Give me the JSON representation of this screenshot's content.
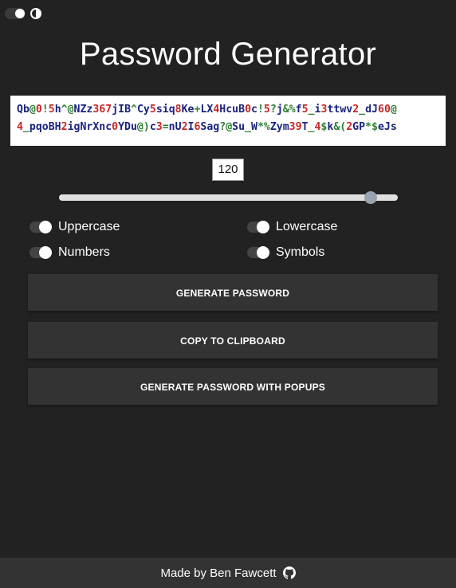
{
  "app": {
    "title": "Password Generator"
  },
  "theme_toggle": {
    "icon": "contrast-icon"
  },
  "password": {
    "segments": [
      [
        {
          "t": "Qb",
          "c": "upper"
        },
        {
          "t": "@",
          "c": "symbol"
        },
        {
          "t": "0",
          "c": "number"
        },
        {
          "t": "!",
          "c": "symbol"
        },
        {
          "t": "5",
          "c": "number"
        },
        {
          "t": "h",
          "c": "lower"
        },
        {
          "t": "^@",
          "c": "symbol"
        },
        {
          "t": "NZz",
          "c": "upper"
        },
        {
          "t": "367",
          "c": "number"
        },
        {
          "t": "jIB",
          "c": "upper"
        },
        {
          "t": "^",
          "c": "symbol"
        },
        {
          "t": "Cy",
          "c": "upper"
        },
        {
          "t": "5",
          "c": "number"
        },
        {
          "t": "siq",
          "c": "lower"
        },
        {
          "t": "8",
          "c": "number"
        },
        {
          "t": "Ke",
          "c": "upper"
        },
        {
          "t": "+",
          "c": "symbol"
        },
        {
          "t": "LX",
          "c": "upper"
        },
        {
          "t": "4",
          "c": "number"
        },
        {
          "t": "HcuB",
          "c": "upper"
        },
        {
          "t": "0",
          "c": "number"
        },
        {
          "t": "c",
          "c": "lower"
        },
        {
          "t": "!",
          "c": "symbol"
        },
        {
          "t": "5",
          "c": "number"
        },
        {
          "t": "?",
          "c": "symbol"
        },
        {
          "t": "j",
          "c": "lower"
        },
        {
          "t": "&%",
          "c": "symbol"
        },
        {
          "t": "f",
          "c": "lower"
        },
        {
          "t": "5",
          "c": "number"
        },
        {
          "t": "_",
          "c": "symbol"
        },
        {
          "t": "i",
          "c": "lower"
        },
        {
          "t": "3",
          "c": "number"
        },
        {
          "t": "ttwv",
          "c": "lower"
        },
        {
          "t": "2",
          "c": "number"
        },
        {
          "t": "_",
          "c": "symbol"
        },
        {
          "t": "dJ",
          "c": "lower"
        },
        {
          "t": "60",
          "c": "number"
        },
        {
          "t": "@",
          "c": "symbol"
        }
      ],
      [
        {
          "t": "4",
          "c": "number"
        },
        {
          "t": "_",
          "c": "symbol"
        },
        {
          "t": "pqoBH",
          "c": "lower"
        },
        {
          "t": "2",
          "c": "number"
        },
        {
          "t": "igNrXnc",
          "c": "lower"
        },
        {
          "t": "0",
          "c": "number"
        },
        {
          "t": "YDu",
          "c": "upper"
        },
        {
          "t": "@)",
          "c": "symbol"
        },
        {
          "t": "c",
          "c": "lower"
        },
        {
          "t": "3",
          "c": "number"
        },
        {
          "t": "=",
          "c": "symbol"
        },
        {
          "t": "nU",
          "c": "upper"
        },
        {
          "t": "2",
          "c": "number"
        },
        {
          "t": "I",
          "c": "upper"
        },
        {
          "t": "6",
          "c": "number"
        },
        {
          "t": "Sag",
          "c": "upper"
        },
        {
          "t": "?@",
          "c": "symbol"
        },
        {
          "t": "Su",
          "c": "upper"
        },
        {
          "t": "_",
          "c": "symbol"
        },
        {
          "t": "W",
          "c": "upper"
        },
        {
          "t": "*%",
          "c": "symbol"
        },
        {
          "t": "Zym",
          "c": "upper"
        },
        {
          "t": "39",
          "c": "number"
        },
        {
          "t": "T",
          "c": "upper"
        },
        {
          "t": "_",
          "c": "symbol"
        },
        {
          "t": "4",
          "c": "number"
        },
        {
          "t": "$",
          "c": "symbol"
        },
        {
          "t": "k",
          "c": "lower"
        },
        {
          "t": "&(",
          "c": "symbol"
        },
        {
          "t": "2",
          "c": "number"
        },
        {
          "t": "GP",
          "c": "upper"
        },
        {
          "t": "*$",
          "c": "symbol"
        },
        {
          "t": "eJs",
          "c": "upper"
        }
      ]
    ],
    "colors": {
      "upper": "#1a237e",
      "lower": "#1a237e",
      "number": "#c62828",
      "symbol": "#2e7d32"
    }
  },
  "length": {
    "value": "120",
    "min": 1,
    "max": 128,
    "current": 120
  },
  "options": {
    "uppercase": {
      "label": "Uppercase",
      "checked": true
    },
    "lowercase": {
      "label": "Lowercase",
      "checked": true
    },
    "numbers": {
      "label": "Numbers",
      "checked": true
    },
    "symbols": {
      "label": "Symbols",
      "checked": true
    }
  },
  "buttons": {
    "generate": "GENERATE PASSWORD",
    "copy": "COPY TO CLIPBOARD",
    "generate_popups": "GENERATE PASSWORD WITH POPUPS"
  },
  "footer": {
    "text": "Made by Ben Fawcett",
    "icon": "github-icon"
  }
}
